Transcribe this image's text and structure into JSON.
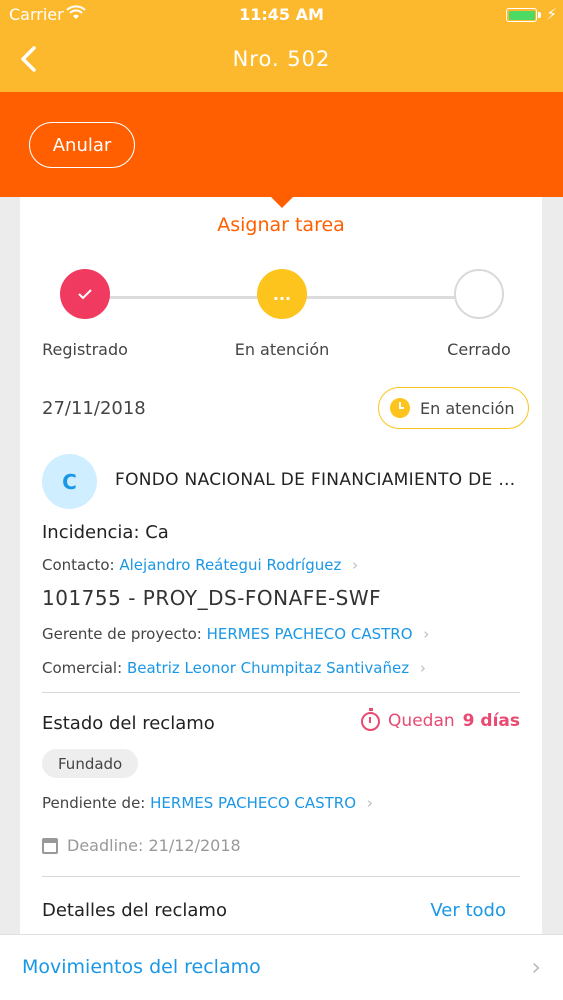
{
  "status_bar": {
    "carrier": "Carrier",
    "time": "11:45 AM",
    "charging_icon": "bolt-icon",
    "battery_level": 1.0
  },
  "nav": {
    "title": "Nro. 502",
    "back_icon": "chevron-left-icon"
  },
  "actions": {
    "anular_label": "Anular"
  },
  "card": {
    "assign_task": "Asignar tarea",
    "steps": [
      {
        "label": "Registrado",
        "state": "done",
        "color": "#f03a5f",
        "icon": "check-icon"
      },
      {
        "label": "En atención",
        "state": "current",
        "color": "#fcc41c",
        "icon": "ellipsis-icon",
        "glyph": "..."
      },
      {
        "label": "Cerrado",
        "state": "pending",
        "color": "#d9d9d9"
      }
    ],
    "date": "27/11/2018",
    "status_badge": "En atención",
    "company": {
      "initial": "C",
      "name": "FONDO NACIONAL DE FINANCIAMIENTO DE LA ACTIVIDAD EMPRESARIAL DEL ESTADO"
    },
    "incidencia": "Incidencia: Ca",
    "contacto": {
      "label": "Contacto:",
      "value": "Alejandro Reátegui Rodríguez"
    },
    "proyecto": "101755 - PROY_DS-FONAFE-SWF",
    "gerente": {
      "label": "Gerente de proyecto:",
      "value": "HERMES PACHECO CASTRO"
    },
    "comercial": {
      "label": "Comercial:",
      "value": "Beatriz Leonor Chumpitaz Santivañez"
    },
    "estado": {
      "title": "Estado del reclamo",
      "remaining_prefix": "Quedan",
      "remaining_value": "9 días",
      "chip": "Fundado",
      "pendiente_label": "Pendiente de:",
      "pendiente_value": "HERMES PACHECO CASTRO",
      "deadline": "Deadline: 21/12/2018"
    },
    "detalles": {
      "title": "Detalles del reclamo",
      "ver_todo": "Ver todo"
    }
  },
  "bottom": {
    "label": "Movimientos del reclamo"
  },
  "colors": {
    "header_yellow": "#fdb92d",
    "accent_orange": "#ff5f00",
    "link_blue": "#1a97e6",
    "alert_pink": "#e84a72"
  }
}
